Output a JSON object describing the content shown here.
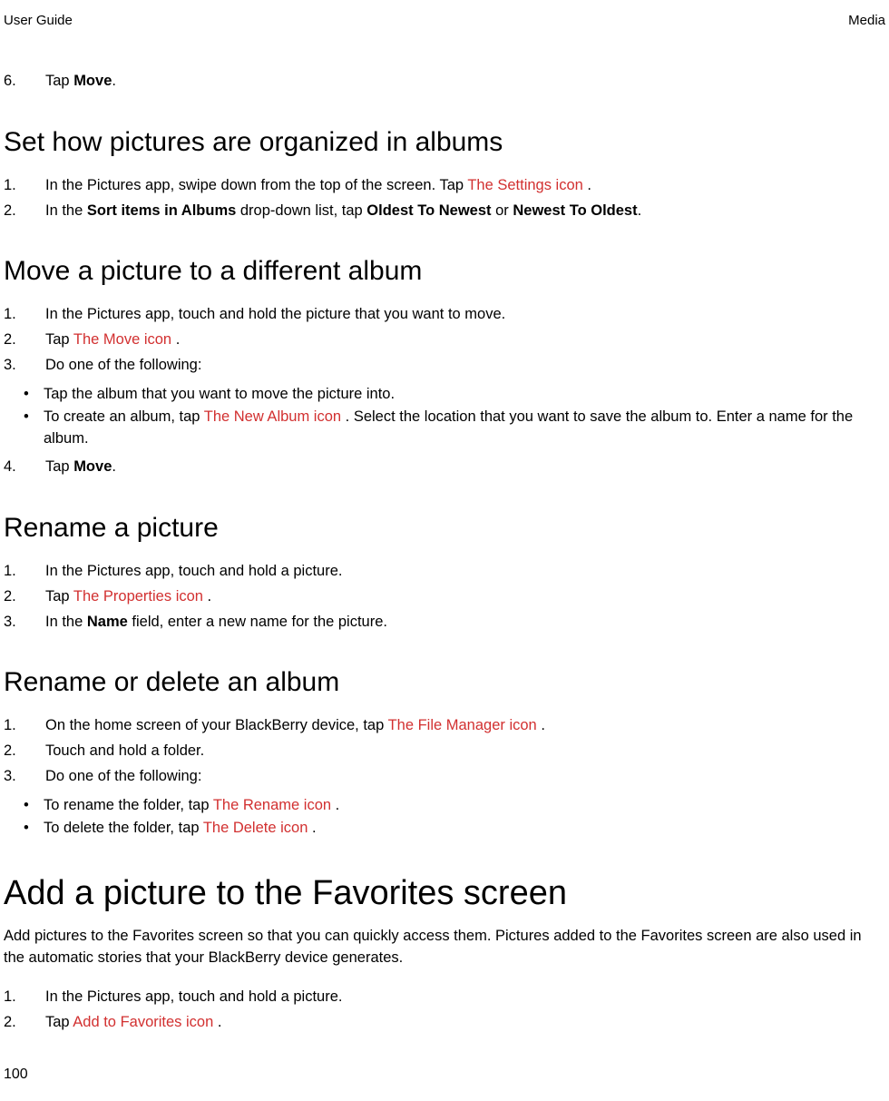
{
  "header": {
    "left": "User Guide",
    "right": "Media"
  },
  "intro_step": {
    "num": "6.",
    "pre": "Tap ",
    "bold": "Move",
    "post": "."
  },
  "s1": {
    "heading": "Set how pictures are organized in albums",
    "i1": {
      "num": "1.",
      "a": "In the Pictures app, swipe down from the top of the screen. Tap  ",
      "b": "The Settings icon",
      "c": " ."
    },
    "i2": {
      "num": "2.",
      "a": "In the ",
      "b": "Sort items in Albums",
      "c": " drop-down list, tap ",
      "d": "Oldest To Newest",
      "e": " or ",
      "f": "Newest To Oldest",
      "g": "."
    }
  },
  "s2": {
    "heading": "Move a picture to a different album",
    "i1": {
      "num": "1.",
      "t": "In the Pictures app, touch and hold the picture that you want to move."
    },
    "i2": {
      "num": "2.",
      "a": "Tap  ",
      "b": "The Move icon",
      "c": " ."
    },
    "i3": {
      "num": "3.",
      "t": "Do one of the following:"
    },
    "b1": {
      "t": "Tap the album that you want to move the picture into."
    },
    "b2": {
      "a": "To create an album, tap  ",
      "b": "The New Album icon",
      "c": " . Select the location that you want to save the album to. Enter a name for the album."
    },
    "i4": {
      "num": "4.",
      "a": "Tap ",
      "b": "Move",
      "c": "."
    }
  },
  "s3": {
    "heading": "Rename a picture",
    "i1": {
      "num": "1.",
      "t": "In the Pictures app, touch and hold a picture."
    },
    "i2": {
      "num": "2.",
      "a": "Tap  ",
      "b": "The Properties icon",
      "c": " ."
    },
    "i3": {
      "num": "3.",
      "a": "In the ",
      "b": "Name",
      "c": " field, enter a new name for the picture."
    }
  },
  "s4": {
    "heading": "Rename or delete an album",
    "i1": {
      "num": "1.",
      "a": "On the home screen of your BlackBerry device, tap  ",
      "b": "The File Manager icon",
      "c": " ."
    },
    "i2": {
      "num": "2.",
      "t": "Touch and hold a folder."
    },
    "i3": {
      "num": "3.",
      "t": "Do one of the following:"
    },
    "b1": {
      "a": "To rename the folder, tap  ",
      "b": "The Rename icon",
      "c": " ."
    },
    "b2": {
      "a": "To delete the folder, tap  ",
      "b": "The Delete icon",
      "c": " ."
    }
  },
  "s5": {
    "heading": "Add a picture to the Favorites screen",
    "para": "Add pictures to the Favorites screen so that you can quickly access them. Pictures added to the Favorites screen are also used in the automatic stories that your BlackBerry device generates.",
    "i1": {
      "num": "1.",
      "t": "In the Pictures app, touch and hold a picture."
    },
    "i2": {
      "num": "2.",
      "a": "Tap  ",
      "b": "Add to Favorites icon",
      "c": " ."
    }
  },
  "page_number": "100"
}
